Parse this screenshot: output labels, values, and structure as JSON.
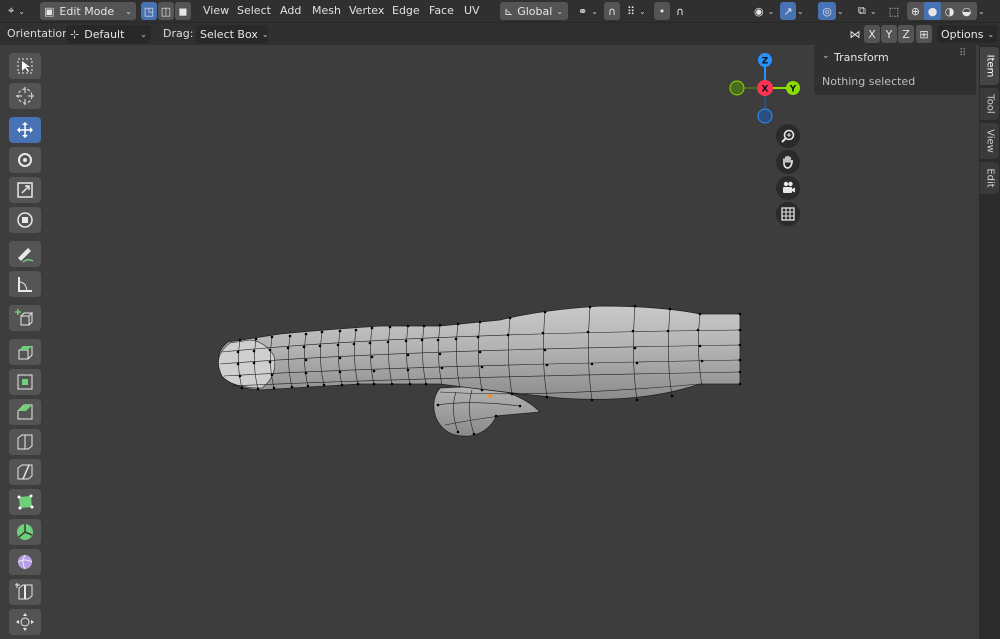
{
  "header": {
    "mode": "Edit Mode",
    "menus": [
      "View",
      "Select",
      "Add",
      "Mesh",
      "Vertex",
      "Edge",
      "Face",
      "UV"
    ],
    "transform_orientation": "Global"
  },
  "tool_header": {
    "orientation_label": "Orientation:",
    "orientation_value": "Default",
    "drag_label": "Drag:",
    "drag_value": "Select Box",
    "mirror_x": "X",
    "mirror_y": "Y",
    "mirror_z": "Z",
    "options": "Options"
  },
  "gizmo": {
    "z": "Z",
    "x": "X",
    "y": "Y"
  },
  "sidebar": {
    "panel_title": "Transform",
    "panel_text": "Nothing selected",
    "tabs": [
      "Item",
      "Tool",
      "View",
      "Edit"
    ],
    "active_tab": "Item"
  },
  "colors": {
    "viewport": "#3d3d3d",
    "accent": "#4772b3",
    "axis_x": "#ff3352",
    "axis_y": "#8bdc00",
    "axis_z": "#2890ff"
  }
}
